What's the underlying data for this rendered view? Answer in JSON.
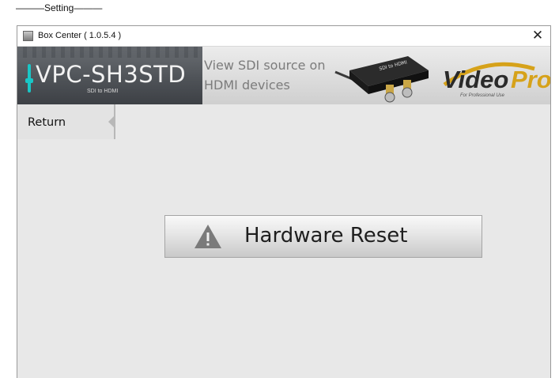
{
  "caption": "———Setting———",
  "window": {
    "title": "Box Center ( 1.0.5.4 )",
    "close_glyph": "✕"
  },
  "banner": {
    "model": "VPC-SH3STD",
    "model_sub": "SDI to HDMI",
    "tagline_line1": "View SDI source on",
    "tagline_line2": "HDMI devices",
    "device_label": "SDI to HDMI",
    "brand_part1": "Video",
    "brand_part2": "Pro",
    "brand_sub": "For Professional Use",
    "accent_color": "#19c6c6"
  },
  "nav": {
    "return_label": "Return"
  },
  "main": {
    "reset_label": "Hardware Reset",
    "reset_icon": "warning-icon"
  }
}
